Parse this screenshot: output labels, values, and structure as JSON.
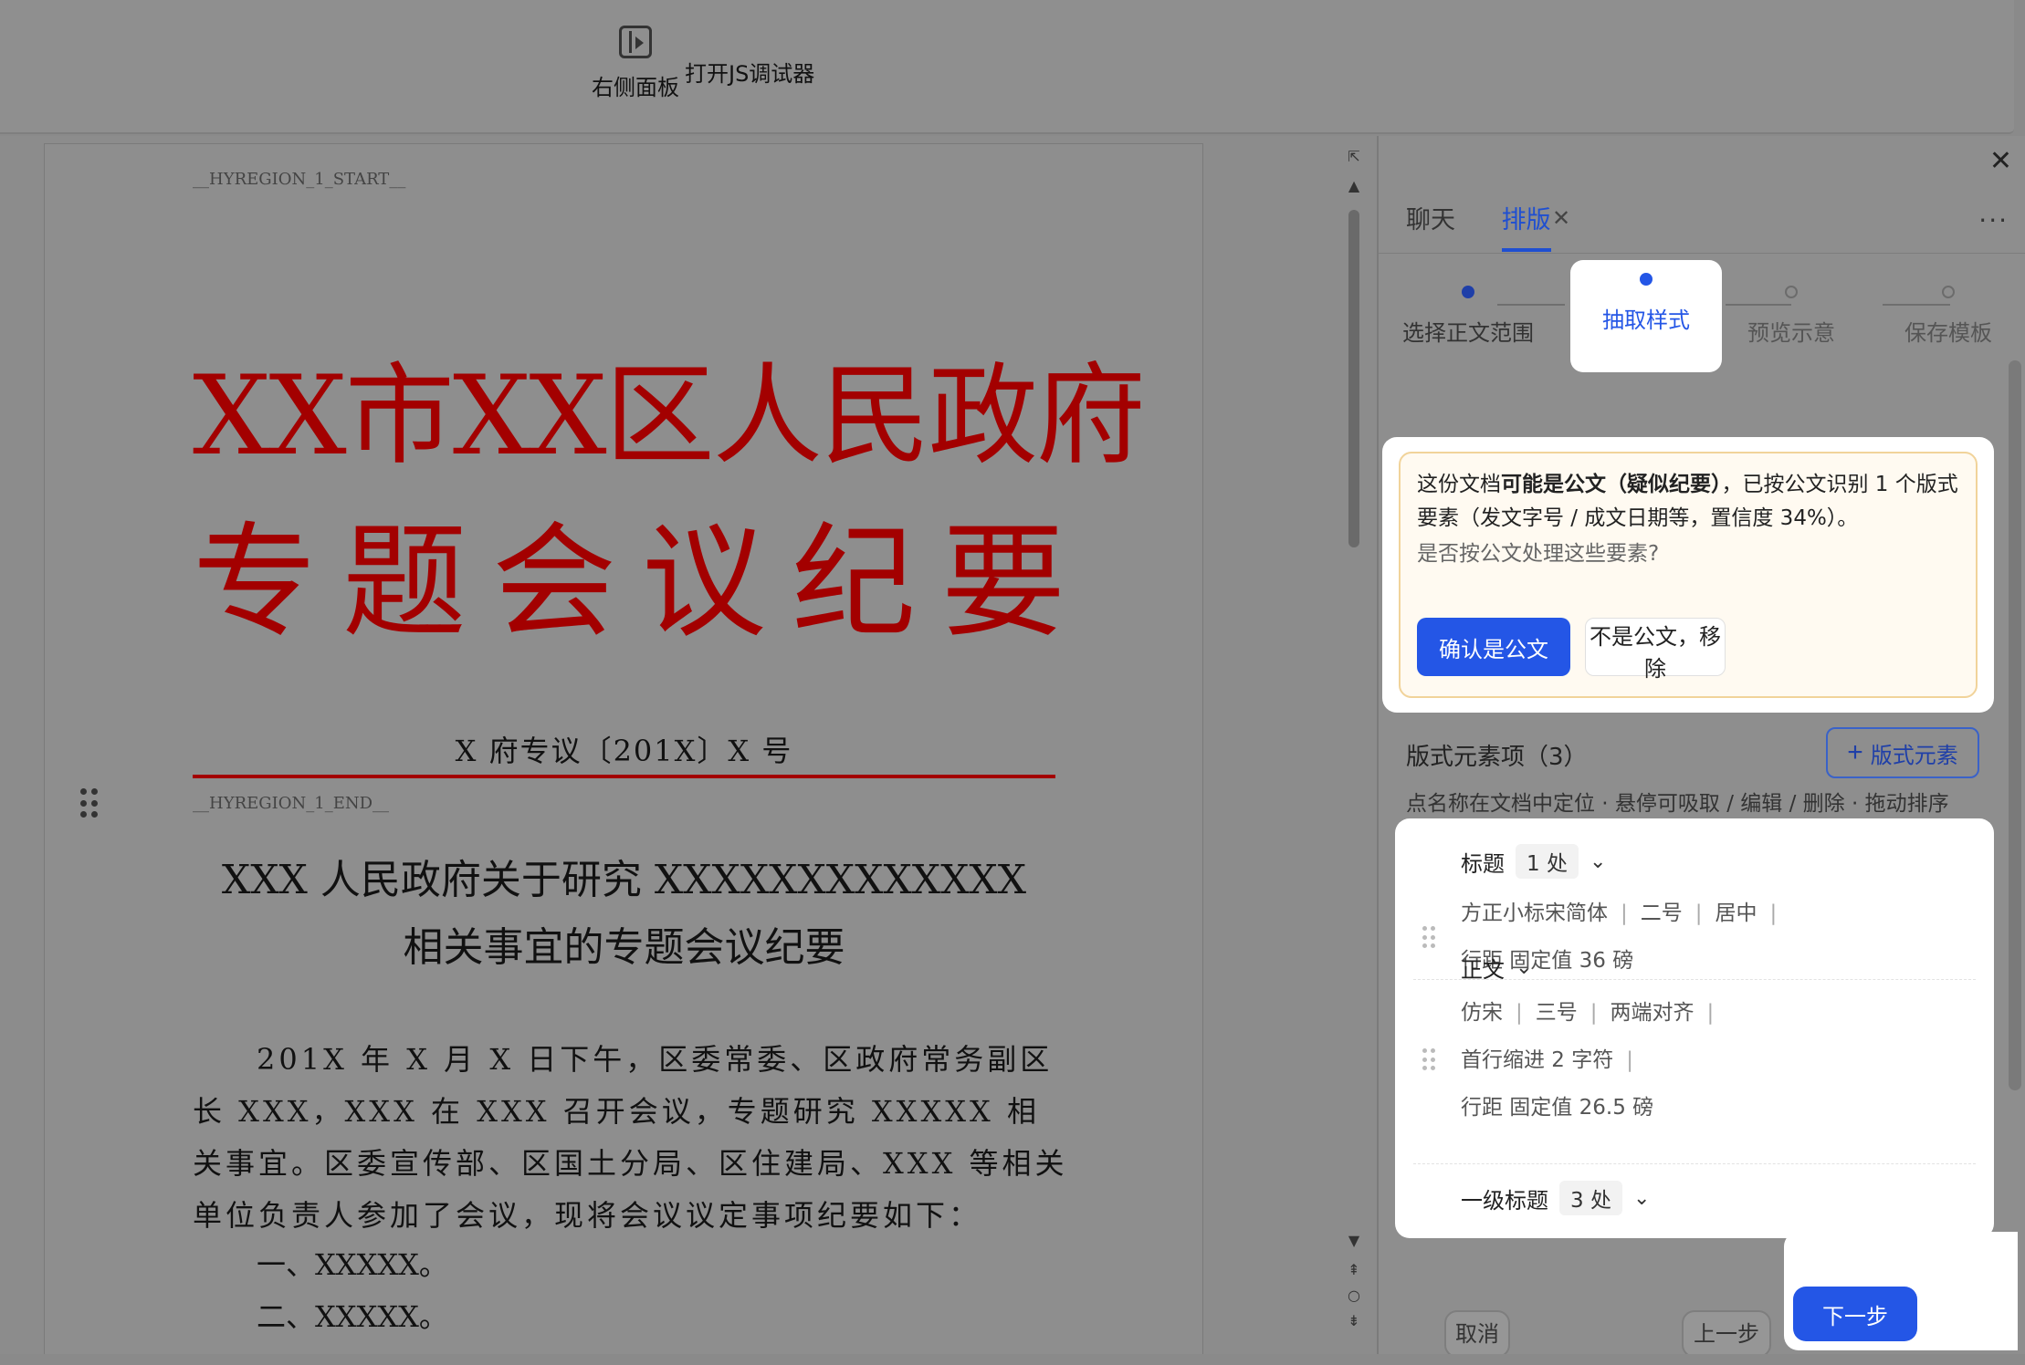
{
  "toolbar": {
    "right_panel_label": "右侧面板",
    "js_debugger_label": "打开JS调试器"
  },
  "document": {
    "region_start": "__HYREGION_1_START__",
    "region_end": "__HYREGION_1_END__",
    "red_title_line1": "XX市XX区人民政府",
    "red_title_line2": "专题会议纪要",
    "doc_number": "X 府专议〔201X〕X 号",
    "heading_line1": "XXX 人民政府关于研究 XXXXXXXXXXXXX",
    "heading_line2": "相关事宜的专题会议纪要",
    "body_paragraph": "201X 年 X 月 X 日下午，区委常委、区政府常务副区长 XXX，XXX 在 XXX 召开会议，专题研究 XXXXX 相关事宜。区委宣传部、区国土分局、区住建局、XXX 等相关单位负责人参加了会议，现将会议议定事项纪要如下：",
    "item1": "一、XXXXX。",
    "item2": "二、XXXXX。"
  },
  "panel": {
    "tabs": [
      {
        "label": "聊天",
        "active": false
      },
      {
        "label": "排版",
        "active": true
      }
    ],
    "steps": [
      {
        "label": "选择正文范围",
        "state": "done"
      },
      {
        "label": "抽取样式",
        "state": "current"
      },
      {
        "label": "预览示意",
        "state": "todo"
      },
      {
        "label": "保存模板",
        "state": "todo"
      }
    ],
    "notice": {
      "prefix": "这份文档",
      "bold": "可能是公文（疑似纪要）",
      "rest": "，已按公文识别 1 个版式要素（发文字号 / 成文日期等，置信度 34%）。",
      "question": "是否按公文处理这些要素?",
      "confirm_label": "确认是公文",
      "reject_label": "不是公文，移除"
    },
    "elements": {
      "title": "版式元素项（3）",
      "add_label": "版式元素",
      "hint": "点名称在文档中定位 · 悬停可吸取 / 编辑 / 删除 · 拖动排序",
      "items": [
        {
          "name": "标题",
          "count": "1 处",
          "line1": [
            "方正小标宋简体",
            "二号",
            "居中"
          ],
          "line2": "行距 固定值 36 磅"
        },
        {
          "name": "正文",
          "count": "",
          "line1": [
            "仿宋",
            "三号",
            "两端对齐"
          ],
          "line1b": "首行缩进 2 字符",
          "line2": "行距 固定值 26.5 磅"
        },
        {
          "name": "一级标题",
          "count": "3 处"
        }
      ]
    },
    "footer": {
      "cancel": "取消",
      "prev": "上一步",
      "next": "下一步"
    }
  }
}
